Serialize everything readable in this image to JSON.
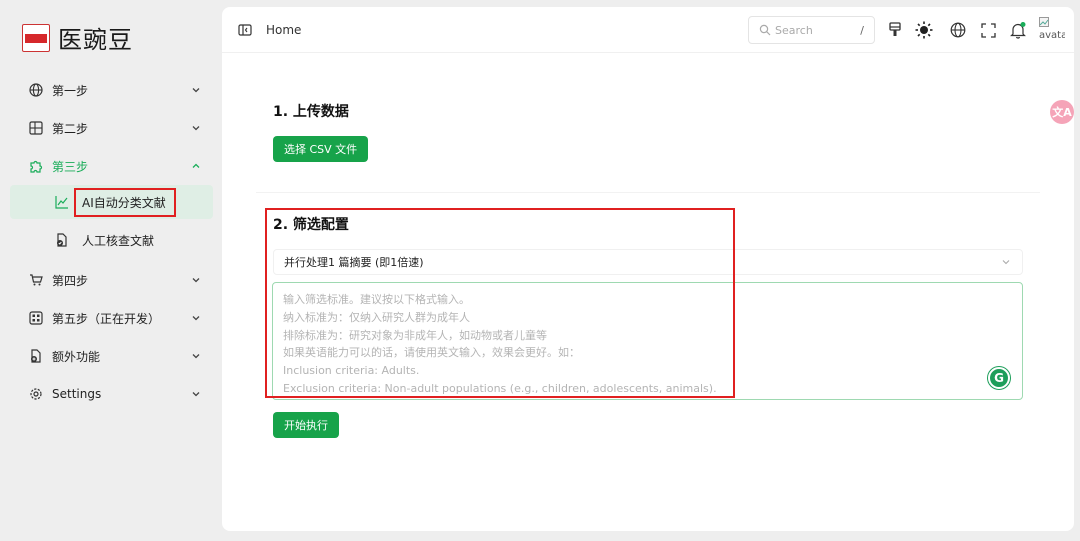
{
  "app": {
    "title": "医豌豆"
  },
  "sidebar": {
    "items": [
      {
        "label": "第一步",
        "icon": "globe-icon"
      },
      {
        "label": "第二步",
        "icon": "layout-icon"
      },
      {
        "label": "第三步",
        "icon": "puzzle-icon"
      },
      {
        "label": "第四步",
        "icon": "cart-icon"
      },
      {
        "label": "第五步（正在开发）",
        "icon": "grid-icon"
      },
      {
        "label": "额外功能",
        "icon": "file-plus-icon"
      },
      {
        "label": "Settings",
        "icon": "gear-icon"
      }
    ],
    "sub_items": [
      {
        "label": "AI自动分类文献",
        "icon": "chart-line-icon"
      },
      {
        "label": "人工核查文献",
        "icon": "file-check-icon"
      }
    ]
  },
  "topbar": {
    "breadcrumb": "Home",
    "search_placeholder": "Search",
    "search_shortcut": "/",
    "avatar_alt": "avatar"
  },
  "upload": {
    "title": "1. 上传数据",
    "button": "选择 CSV 文件"
  },
  "filter": {
    "title": "2. 筛选配置",
    "select_value": "并行处理1 篇摘要 (即1倍速)",
    "textarea_placeholder_lines": [
      "输入筛选标准。建议按以下格式输入。",
      "纳入标准为：仅纳入研究人群为成年人",
      "排除标准为：研究对象为非成年人，如动物或者儿童等",
      "如果英语能力可以的话，请使用英文输入，效果会更好。如：",
      "Inclusion criteria: Adults.",
      "Exclusion criteria: Non-adult populations (e.g., children, adolescents, animals)."
    ],
    "run_button": "开始执行"
  },
  "colors": {
    "accent": "#17a34a",
    "highlight_box": "#e02020",
    "active_bg": "#dfeee5"
  }
}
